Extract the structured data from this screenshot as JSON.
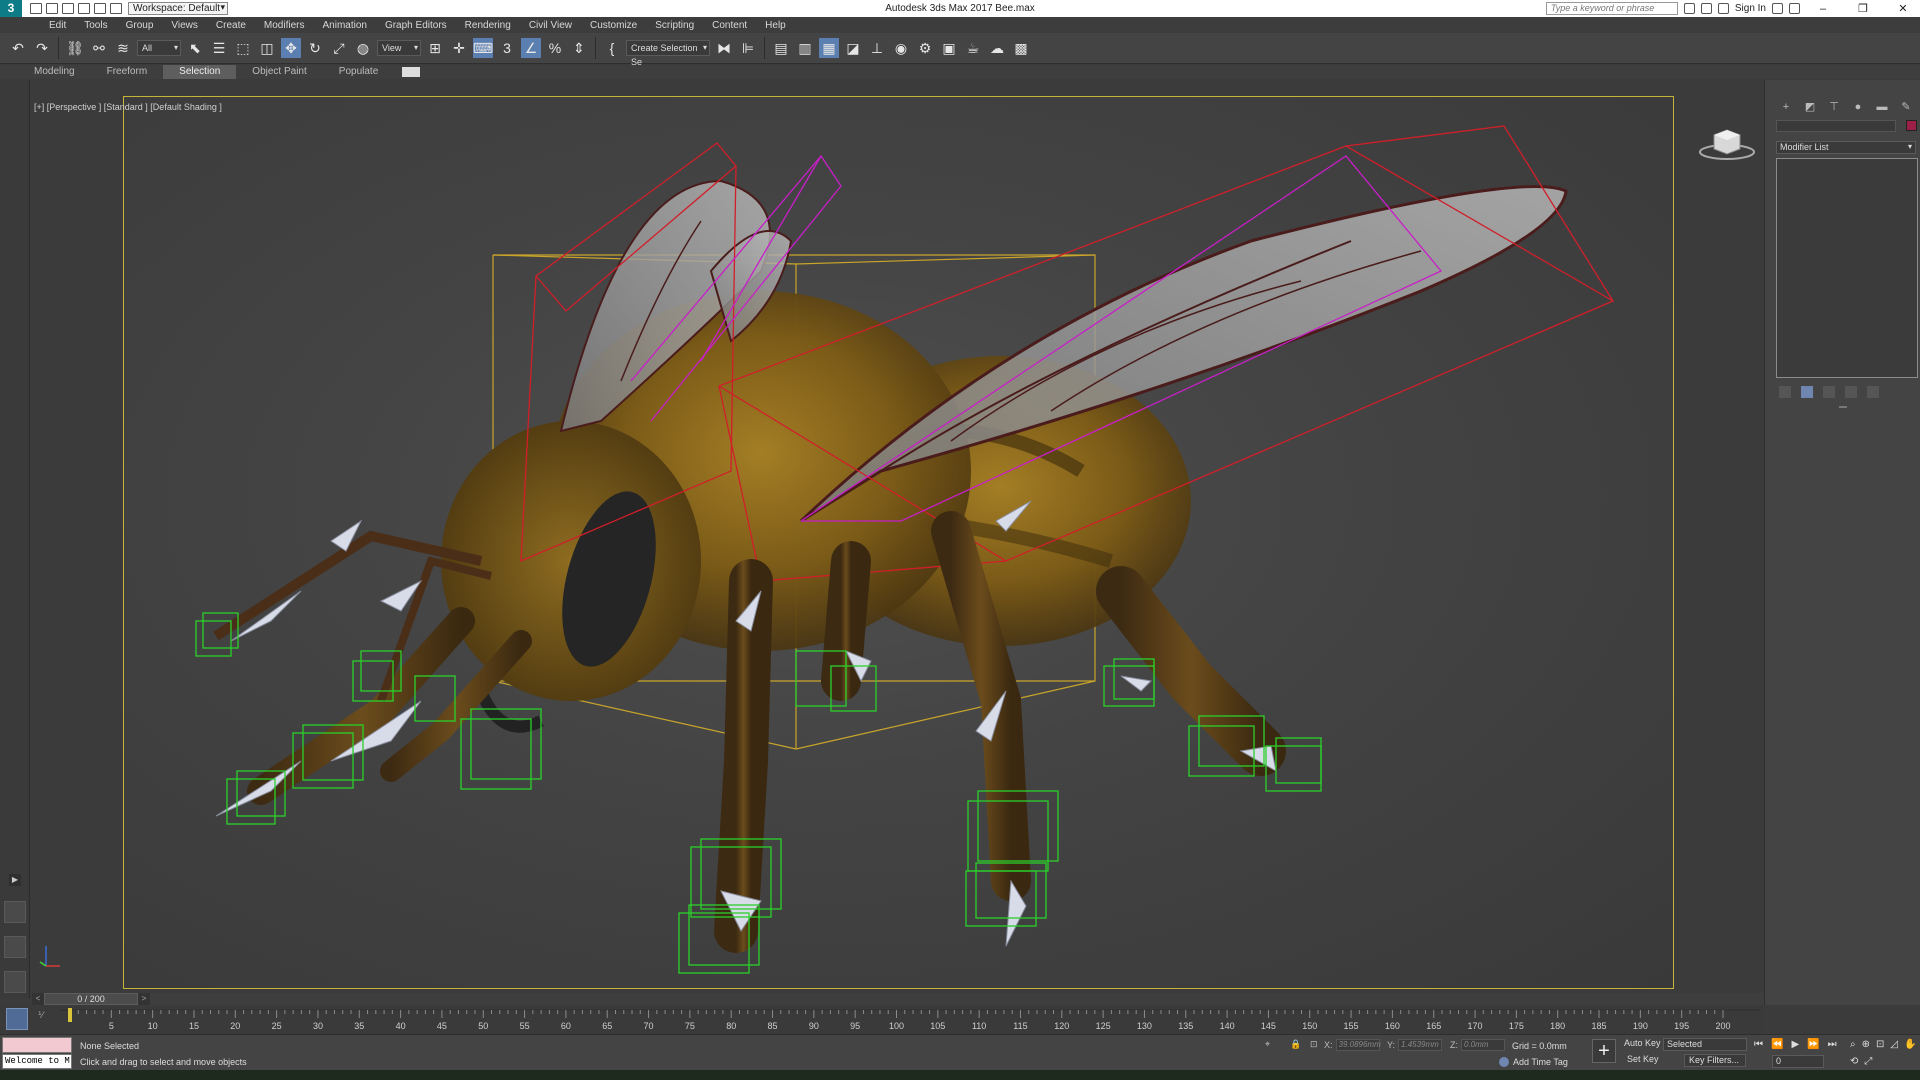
{
  "app": {
    "title": "Autodesk 3ds Max 2017    Bee.max",
    "logo": "3",
    "workspace": "Workspace: Default",
    "search_placeholder": "Type a keyword or phrase",
    "sign_in": "Sign In"
  },
  "menu": [
    "Edit",
    "Tools",
    "Group",
    "Views",
    "Create",
    "Modifiers",
    "Animation",
    "Graph Editors",
    "Rendering",
    "Civil View",
    "Customize",
    "Scripting",
    "Content",
    "Help"
  ],
  "toolbar": {
    "selection_filter": "All",
    "ref_coord": "View",
    "named_selection": "Create Selection Se"
  },
  "ribbon_tabs": [
    "Modeling",
    "Freeform",
    "Selection",
    "Object Paint",
    "Populate"
  ],
  "ribbon_selected": "Selection",
  "viewport": {
    "label": "[+] [Perspective ] [Standard ] [Default Shading ]"
  },
  "command_panel": {
    "modifier_list": "Modifier List",
    "color_swatch": "#9b1f46"
  },
  "timeline": {
    "slider_label": "0 / 200",
    "ticks": [
      "5",
      "10",
      "15",
      "20",
      "25",
      "30",
      "35",
      "40",
      "45",
      "50",
      "55",
      "60",
      "65",
      "70",
      "75",
      "80",
      "85",
      "90",
      "95",
      "100",
      "105",
      "110",
      "115",
      "120",
      "125",
      "130",
      "135",
      "140",
      "145",
      "150",
      "155",
      "160",
      "165",
      "170",
      "175",
      "180",
      "185",
      "190",
      "195",
      "200"
    ]
  },
  "status": {
    "maxscript_text": "Welcome to M",
    "selection": "None Selected",
    "prompt": "Click and drag to select and move objects",
    "x_label": "X:",
    "x_value": "39.0896mm",
    "y_label": "Y:",
    "y_value": "1.4539mm",
    "z_label": "Z:",
    "z_value": "0.0mm",
    "grid": "Grid = 0.0mm",
    "add_time_tag": "Add Time Tag",
    "auto_key": "Auto Key",
    "set_key": "Set Key",
    "key_mode": "Selected",
    "key_filters": "Key Filters...",
    "current_frame": "0"
  },
  "colors": {
    "viewport_border": "#c7b23a",
    "bounding_red": "#d11f2a",
    "bounding_magenta": "#c81fc8",
    "bounding_yellow": "#c9a52a",
    "bone_green": "#2bd12b",
    "fur": "#8a6a1c"
  }
}
